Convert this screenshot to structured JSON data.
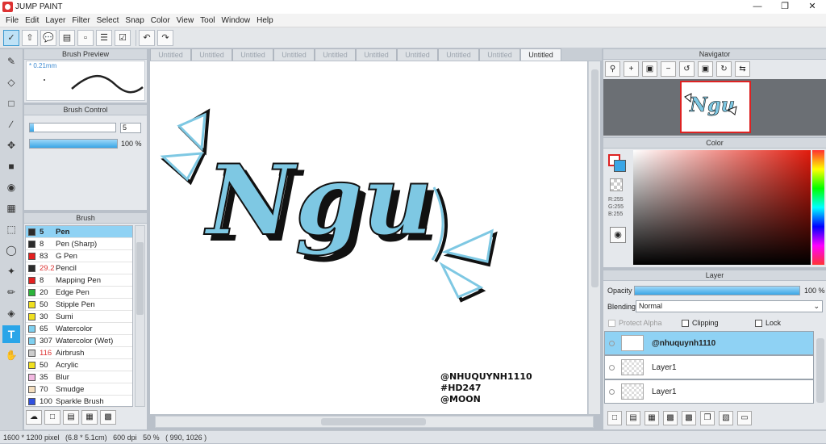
{
  "app": {
    "title": "JUMP PAINT"
  },
  "menu": [
    "File",
    "Edit",
    "Layer",
    "Filter",
    "Select",
    "Snap",
    "Color",
    "View",
    "Tool",
    "Window",
    "Help"
  ],
  "panels": {
    "brush_preview": {
      "title": "Brush Preview",
      "size": "0.21mm"
    },
    "brush_control": {
      "title": "Brush Control",
      "size_value": "5",
      "opacity_value": "100 %",
      "size_fraction": 0.05,
      "opacity_fraction": 1.0
    },
    "brush": {
      "title": "Brush",
      "items": [
        {
          "num": "5",
          "name": "Pen",
          "color": "#2b2b2b",
          "selected": true
        },
        {
          "num": "8",
          "name": "Pen (Sharp)",
          "color": "#2b2b2b"
        },
        {
          "num": "83",
          "name": "G Pen",
          "color": "#e42020"
        },
        {
          "num": "29.2",
          "name": "Pencil",
          "color": "#2b2b2b",
          "num_color": "#d33"
        },
        {
          "num": "8",
          "name": "Mapping Pen",
          "color": "#e42020"
        },
        {
          "num": "20",
          "name": "Edge Pen",
          "color": "#2bb43a"
        },
        {
          "num": "50",
          "name": "Stipple Pen",
          "color": "#f0e020"
        },
        {
          "num": "30",
          "name": "Sumi",
          "color": "#f0e020"
        },
        {
          "num": "65",
          "name": "Watercolor",
          "color": "#7fd0f0"
        },
        {
          "num": "307",
          "name": "Watercolor (Wet)",
          "color": "#7fd0f0"
        },
        {
          "num": "116",
          "name": "Airbrush",
          "color": "#cccccc",
          "num_color": "#d33"
        },
        {
          "num": "50",
          "name": "Acrylic",
          "color": "#f0e020"
        },
        {
          "num": "35",
          "name": "Blur",
          "color": "#f2b8e0"
        },
        {
          "num": "70",
          "name": "Smudge",
          "color": "#f5dfc0"
        },
        {
          "num": "100",
          "name": "Sparkle Brush",
          "color": "#3050e0"
        }
      ]
    },
    "navigator": {
      "title": "Navigator"
    },
    "color": {
      "title": "Color",
      "r": "R:255",
      "g": "G:255",
      "b": "B:255"
    },
    "layer": {
      "title": "Layer",
      "opacity_label": "Opacity",
      "opacity_value": "100 %",
      "blending_label": "Blending",
      "blending_value": "Normal",
      "clipping_label": "Clipping",
      "lock_label": "Lock",
      "protect_alpha_label": "Protect Alpha",
      "layers": [
        {
          "name": "@nhuquynh1110",
          "selected": true
        },
        {
          "name": "Layer1"
        },
        {
          "name": "Layer1"
        }
      ]
    }
  },
  "tabs": [
    "Untitled",
    "Untitled",
    "Untitled",
    "Untitled",
    "Untitled",
    "Untitled",
    "Untitled",
    "Untitled",
    "Untitled",
    "Untitled"
  ],
  "canvas": {
    "artwork_text": "Ngu",
    "credit_lines": [
      "@NHUQUYNH1110",
      "#HD247",
      "@MOON"
    ]
  },
  "status": "1600 * 1200 pixel   (6.8 * 5.1cm)   600 dpi   50 %   ( 990, 1026 )",
  "colors": {
    "accent": "#3aa6e6",
    "art_blue": "#7ec8e3",
    "outline": "#111111"
  }
}
